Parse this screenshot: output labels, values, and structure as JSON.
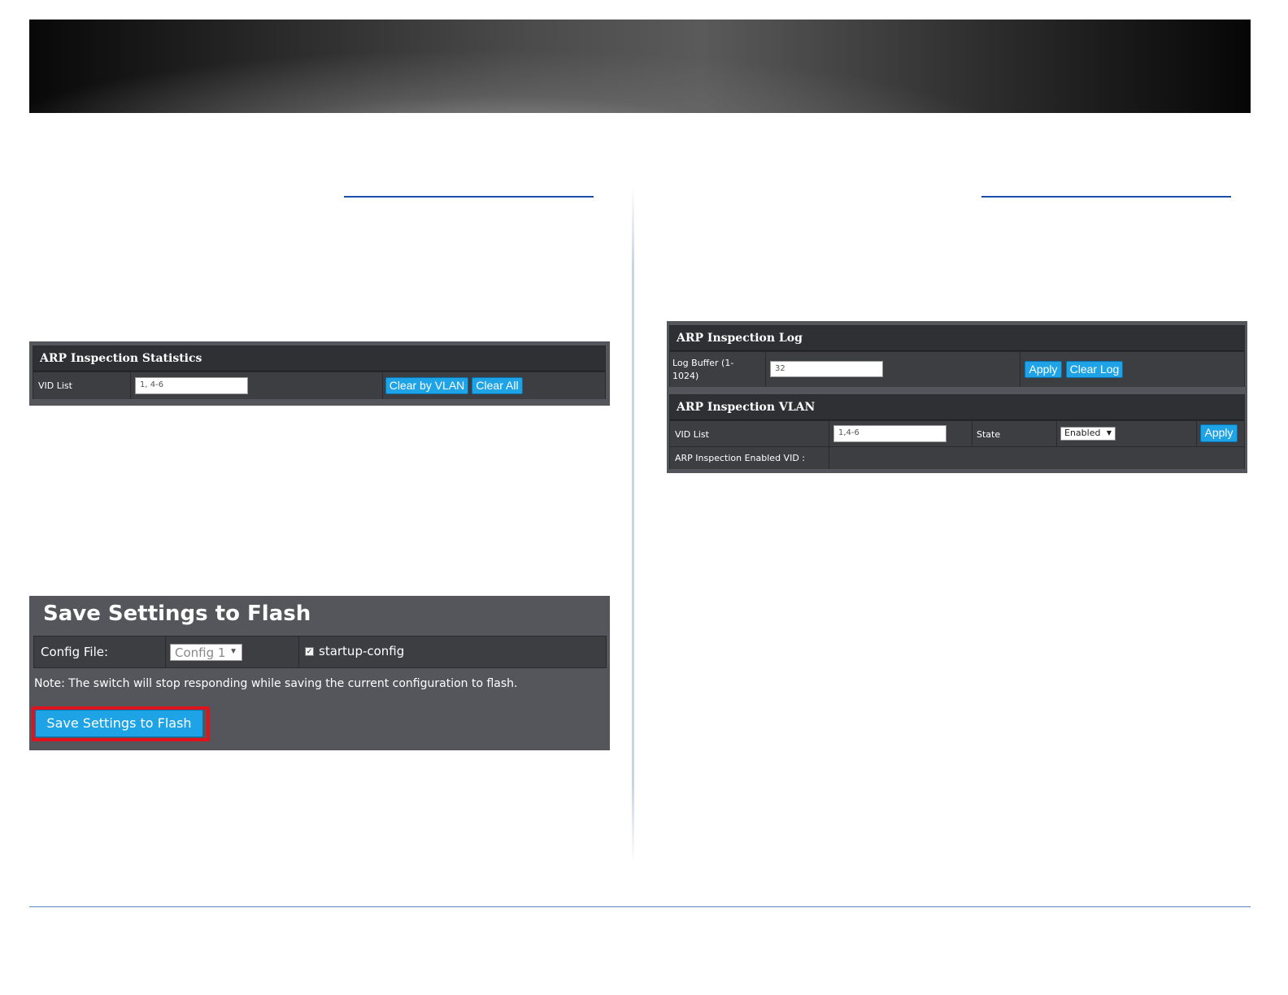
{
  "stats_panel": {
    "title": "ARP Inspection Statistics",
    "vid_list_label": "VID List",
    "vid_list_value": "1, 4-6",
    "clear_by_vlan_label": "Clear by VLAN",
    "clear_all_label": "Clear All"
  },
  "log_panel": {
    "title": "ARP Inspection Log",
    "log_buffer_label_line1": "Log Buffer (1-",
    "log_buffer_label_line2": "1024)",
    "log_buffer_value": "32",
    "apply_label": "Apply",
    "clear_log_label": "Clear Log"
  },
  "vlan_panel": {
    "title": "ARP Inspection VLAN",
    "vid_list_label": "VID List",
    "vid_list_value": "1,4-6",
    "state_label": "State",
    "state_value": "Enabled",
    "apply_label": "Apply",
    "enabled_vid_label": "ARP Inspection Enabled VID :",
    "enabled_vid_value": ""
  },
  "flash_panel": {
    "title": "Save Settings to Flash",
    "config_file_label": "Config File:",
    "config_file_value": "Config 1",
    "startup_config_label": "startup-config",
    "note": "Note: The switch will stop responding while saving the current configuration to flash.",
    "save_button_label": "Save Settings to Flash"
  },
  "colors": {
    "button_blue": "#1ea3e6",
    "highlight_red": "#e0121c",
    "panel_gray": "#55565b"
  }
}
